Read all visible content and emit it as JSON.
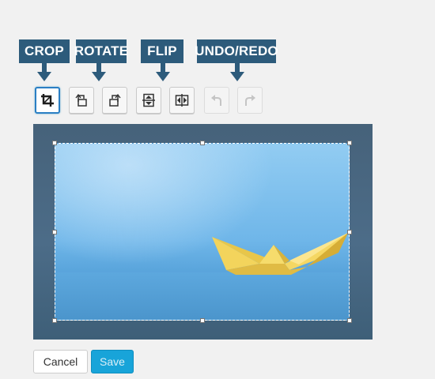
{
  "callouts": {
    "crop": "CROP",
    "rotate": "ROTATE",
    "flip": "FLIP",
    "undo_redo": "UNDO/REDO"
  },
  "toolbar": {
    "buttons": [
      {
        "icon": "crop-icon",
        "state": "active"
      },
      {
        "icon": "rotate-left-icon",
        "state": "normal"
      },
      {
        "icon": "rotate-right-icon",
        "state": "normal"
      },
      {
        "icon": "flip-vertical-icon",
        "state": "normal"
      },
      {
        "icon": "flip-horizontal-icon",
        "state": "normal"
      },
      {
        "icon": "undo-icon",
        "state": "disabled"
      },
      {
        "icon": "redo-icon",
        "state": "disabled"
      }
    ]
  },
  "image": {
    "subject": "paper boat",
    "crop_selection": "active"
  },
  "footer": {
    "cancel_label": "Cancel",
    "save_label": "Save"
  },
  "colors": {
    "callout_bg": "#2d5b7b",
    "active_border": "#2b7fc4",
    "save_bg": "#18a4d9",
    "page_bg": "#f1f1f1"
  }
}
